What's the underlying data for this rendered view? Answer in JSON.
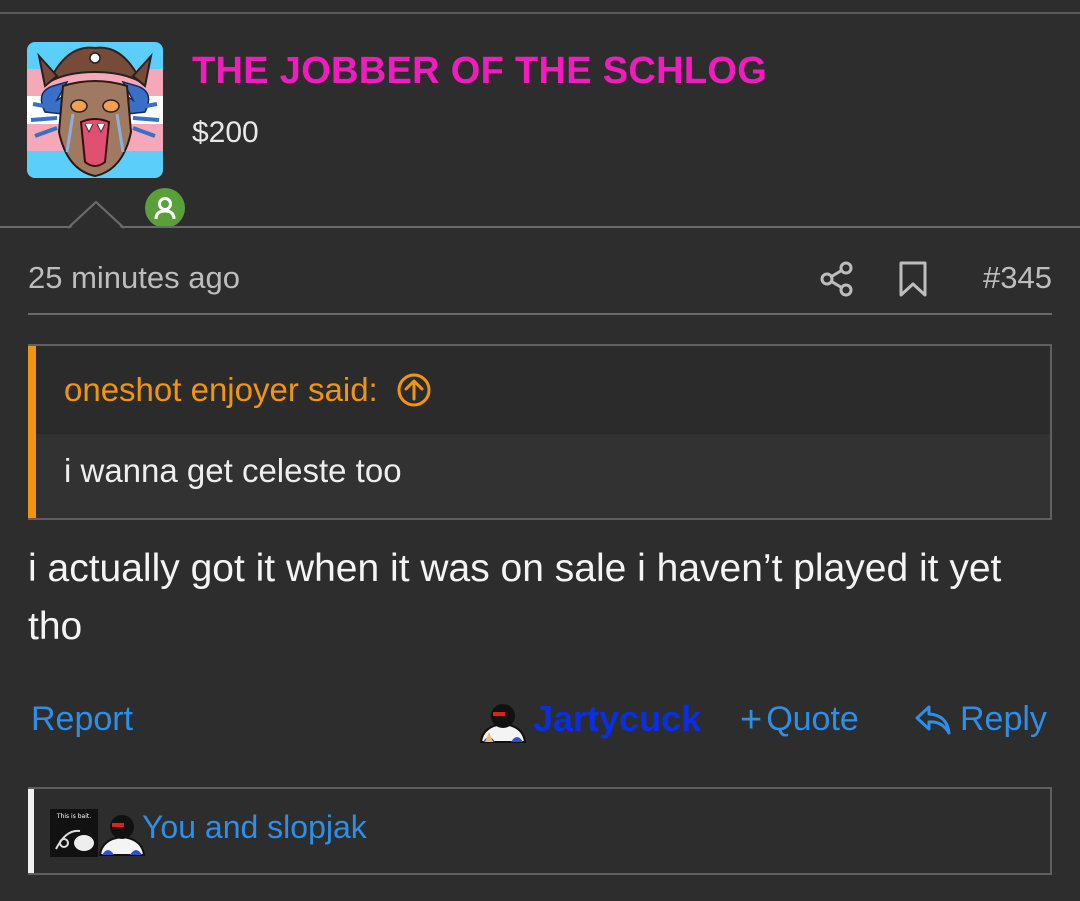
{
  "post": {
    "username": "THE JOBBER OF THE SCHLOG",
    "user_title": "$200",
    "timestamp": "25 minutes ago",
    "post_number": "#345",
    "quote": {
      "author_label": "oneshot enjoyer said:",
      "body": "i wanna get celeste too"
    },
    "message": "i actually got it when it was on sale i haven’t played it yet tho"
  },
  "actions": {
    "report_label": "Report",
    "reaction_label": "Jartycuck",
    "quote_label": "Quote",
    "reply_label": "Reply"
  },
  "reactions_summary": {
    "text": "You and slopjak",
    "image_caption": "This is bait."
  },
  "icons": {
    "share": "share-icon",
    "bookmark": "bookmark-icon",
    "quote_jump": "arrow-up-circle-icon",
    "reply": "reply-arrow-icon",
    "online": "user-online-icon"
  },
  "colors": {
    "background": "#2d2d2d",
    "username": "#f21bc0",
    "link": "#2d8fe8",
    "quote_accent": "#f0960e",
    "reaction_label": "#0a2ee0",
    "online": "#5aa03a"
  }
}
